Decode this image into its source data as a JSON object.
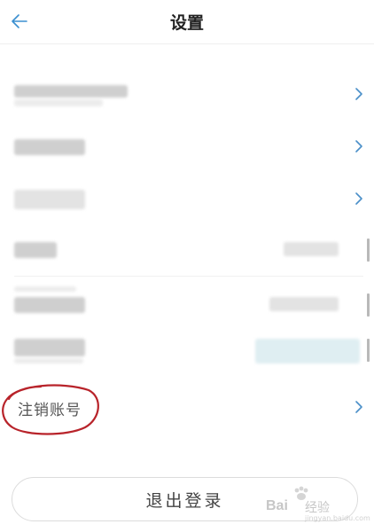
{
  "header": {
    "title": "设置",
    "back_icon": "arrow-left-icon"
  },
  "colors": {
    "accent": "#3b8fd0",
    "annotation_red": "#b8232a",
    "chevron": "#4a8fc8"
  },
  "settings_rows": [
    {
      "redacted": true,
      "has_chevron": true
    },
    {
      "redacted": true,
      "has_chevron": true
    },
    {
      "redacted": true,
      "has_chevron": true
    },
    {
      "redacted": true,
      "has_chevron": false
    },
    {
      "redacted": true,
      "has_chevron": false
    },
    {
      "redacted": true,
      "has_chevron": false
    }
  ],
  "cancel_account": {
    "label": "注销账号"
  },
  "logout_button": {
    "label": "退出登录"
  },
  "watermark": {
    "logo": "Bai",
    "name": "经验",
    "sub": "jingyan.baidu.com"
  }
}
